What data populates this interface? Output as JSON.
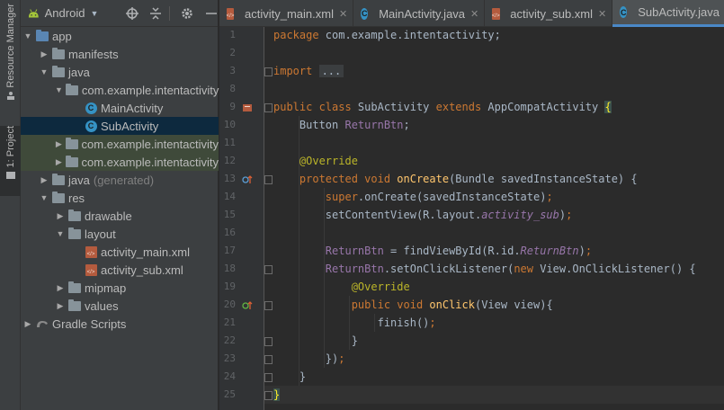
{
  "tool_strip": {
    "resource_manager_label": "Resource Manager",
    "project_label": "1: Project"
  },
  "project_panel": {
    "view_mode": "Android",
    "tree": [
      {
        "label": "app",
        "depth": 0,
        "expanded": true,
        "icon": "folder-blue-icon"
      },
      {
        "label": "manifests",
        "depth": 1,
        "expanded": false,
        "icon": "folder-icon"
      },
      {
        "label": "java",
        "depth": 1,
        "expanded": true,
        "icon": "folder-icon"
      },
      {
        "label": "com.example.intentactivity",
        "depth": 2,
        "expanded": true,
        "icon": "folder-icon"
      },
      {
        "label": "MainActivity",
        "depth": 3,
        "icon": "class-icon"
      },
      {
        "label": "SubActivity",
        "depth": 3,
        "icon": "class-icon",
        "selected": true
      },
      {
        "label": "com.example.intentactivity",
        "depth": 2,
        "expanded": false,
        "icon": "folder-icon"
      },
      {
        "label": "com.example.intentactivity",
        "depth": 2,
        "expanded": false,
        "icon": "folder-icon"
      },
      {
        "label": "java",
        "extra": "(generated)",
        "depth": 1,
        "expanded": false,
        "icon": "folder-icon"
      },
      {
        "label": "res",
        "depth": 1,
        "expanded": true,
        "icon": "folder-icon"
      },
      {
        "label": "drawable",
        "depth": 2,
        "expanded": false,
        "icon": "folder-icon"
      },
      {
        "label": "layout",
        "depth": 2,
        "expanded": true,
        "icon": "folder-icon"
      },
      {
        "label": "activity_main.xml",
        "depth": 3,
        "icon": "xml-icon"
      },
      {
        "label": "activity_sub.xml",
        "depth": 3,
        "icon": "xml-icon"
      },
      {
        "label": "mipmap",
        "depth": 2,
        "expanded": false,
        "icon": "folder-icon"
      },
      {
        "label": "values",
        "depth": 2,
        "expanded": false,
        "icon": "folder-icon"
      },
      {
        "label": "Gradle Scripts",
        "depth": 0,
        "expanded": false,
        "icon": "gradle-icon"
      }
    ]
  },
  "editor_tabs": [
    {
      "label": "activity_main.xml",
      "icon": "xml-icon",
      "active": false
    },
    {
      "label": "MainActivity.java",
      "icon": "class-icon",
      "active": false
    },
    {
      "label": "activity_sub.xml",
      "icon": "xml-icon",
      "active": false
    },
    {
      "label": "SubActivity.java",
      "icon": "class-icon",
      "active": true
    }
  ],
  "colors": {
    "keyword": "#cc7832",
    "annotation": "#bbb529",
    "method_decl": "#ffc66d",
    "field": "#9876aa",
    "text": "#a9b7c6",
    "selection": "#0d293e"
  },
  "code_lines": [
    {
      "n": "1",
      "tokens": [
        [
          "kw",
          "package "
        ],
        [
          "",
          "com.example.intentactivity;"
        ]
      ]
    },
    {
      "n": "2",
      "tokens": []
    },
    {
      "n": "3",
      "tokens": [
        [
          "kw",
          "import "
        ],
        [
          "folded",
          "..."
        ]
      ]
    },
    {
      "n": "8",
      "tokens": []
    },
    {
      "n": "9",
      "tokens": [
        [
          "kw",
          "public class "
        ],
        [
          "",
          "SubActivity "
        ],
        [
          "kw",
          "extends "
        ],
        [
          "",
          "AppCompatActivity "
        ],
        [
          "brace-hl",
          "{"
        ]
      ]
    },
    {
      "n": "10",
      "tokens": [
        [
          "",
          "    Button "
        ],
        [
          "fld",
          "ReturnBtn"
        ],
        [
          "",
          ";"
        ]
      ]
    },
    {
      "n": "11",
      "tokens": []
    },
    {
      "n": "12",
      "tokens": [
        [
          "ann",
          "    @Override"
        ]
      ]
    },
    {
      "n": "13",
      "tokens": [
        [
          "kw",
          "    protected void "
        ],
        [
          "fn",
          "onCreate"
        ],
        [
          "",
          "(Bundle savedInstanceState) {"
        ]
      ]
    },
    {
      "n": "14",
      "tokens": [
        [
          "kw",
          "        super"
        ],
        [
          "",
          ".onCreate(savedInstanceState)"
        ],
        [
          "kw",
          ";"
        ]
      ]
    },
    {
      "n": "15",
      "tokens": [
        [
          "",
          "        setContentView(R.layout."
        ],
        [
          "ital",
          "activity_sub"
        ],
        [
          "",
          ")"
        ],
        [
          "kw",
          ";"
        ]
      ]
    },
    {
      "n": "16",
      "tokens": []
    },
    {
      "n": "17",
      "tokens": [
        [
          "fld",
          "        ReturnBtn"
        ],
        [
          "",
          " = findViewById(R.id."
        ],
        [
          "ital",
          "ReturnBtn"
        ],
        [
          "",
          ")"
        ],
        [
          "kw",
          ";"
        ]
      ]
    },
    {
      "n": "18",
      "tokens": [
        [
          "fld",
          "        ReturnBtn"
        ],
        [
          "",
          ".setOnClickListener("
        ],
        [
          "kw",
          "new "
        ],
        [
          "",
          "View.OnClickListener() {"
        ]
      ]
    },
    {
      "n": "19",
      "tokens": [
        [
          "ann",
          "            @Override"
        ]
      ]
    },
    {
      "n": "20",
      "tokens": [
        [
          "kw",
          "            public void "
        ],
        [
          "fn",
          "onClick"
        ],
        [
          "",
          "(View view){"
        ]
      ]
    },
    {
      "n": "21",
      "tokens": [
        [
          "",
          "                finish()"
        ],
        [
          "kw",
          ";"
        ]
      ]
    },
    {
      "n": "22",
      "tokens": [
        [
          "",
          "            }"
        ]
      ]
    },
    {
      "n": "23",
      "tokens": [
        [
          "",
          "        })"
        ],
        [
          "kw",
          ";"
        ]
      ]
    },
    {
      "n": "24",
      "tokens": [
        [
          "",
          "    }"
        ]
      ]
    },
    {
      "n": "25",
      "tokens": [
        [
          "brace-hl",
          "}"
        ]
      ]
    }
  ]
}
